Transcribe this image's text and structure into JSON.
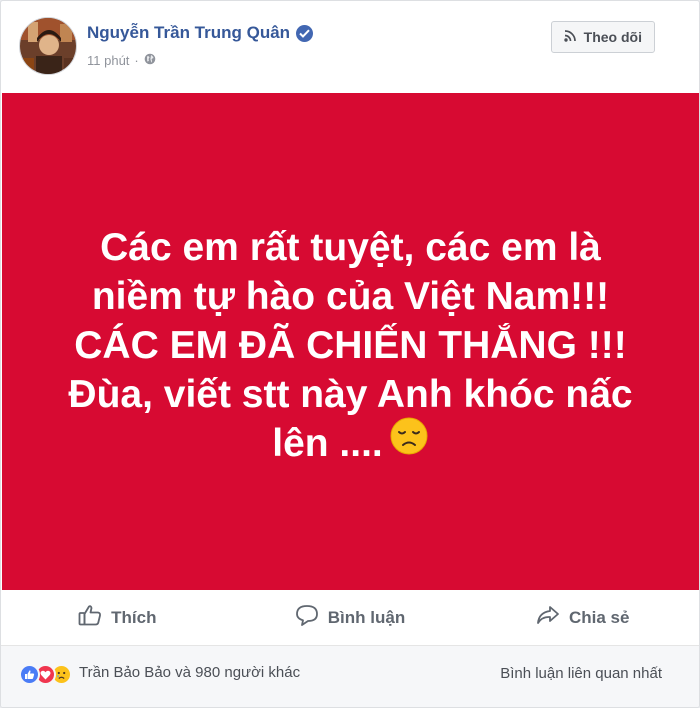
{
  "post": {
    "author": "Nguyễn Trần Trung Quân",
    "time": "11 phút",
    "separator": "·",
    "follow_label": "Theo dõi"
  },
  "status": {
    "lines": [
      "Các em rất tuyệt, các em là",
      "niềm tự hào của Việt Nam!!!",
      "CÁC EM ĐÃ CHIẾN THẮNG !!!",
      "Đùa, viết stt này Anh khóc nấc",
      "lên ...."
    ],
    "background_color": "#d70a32",
    "emoji": "disappointed-face"
  },
  "actions": {
    "like": "Thích",
    "comment": "Bình luận",
    "share": "Chia sẻ"
  },
  "footer": {
    "reactions": [
      "like",
      "love",
      "sad"
    ],
    "likes_summary": "Trần Bảo Bảo và 980 người khác",
    "sort_label": "Bình luận liên quan nhất"
  }
}
